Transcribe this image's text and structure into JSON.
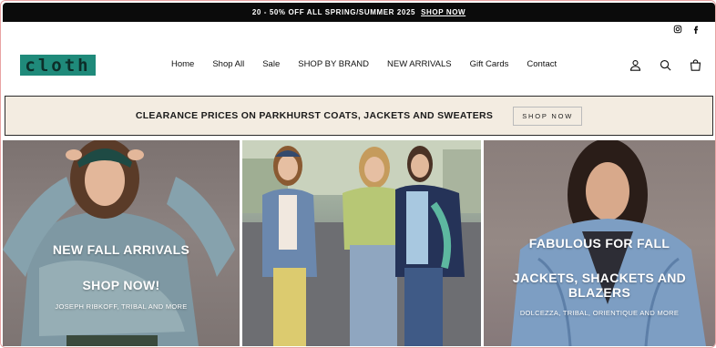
{
  "announcement": {
    "text": "20 - 50% OFF ALL SPRING/SUMMER 2025",
    "link": "SHOP NOW"
  },
  "social": {
    "icons": [
      "instagram-icon",
      "facebook-icon"
    ]
  },
  "header": {
    "logo_text": "cloth",
    "logo_color": "#1f8a7a",
    "nav": [
      "Home",
      "Shop All",
      "Sale",
      "SHOP BY BRAND",
      "NEW ARRIVALS",
      "Gift Cards",
      "Contact"
    ],
    "icons": [
      "account-icon",
      "search-icon",
      "cart-icon"
    ]
  },
  "promo": {
    "text": "CLEARANCE PRICES ON PARKHURST COATS, JACKETS AND SWEATERS",
    "button": "SHOP NOW",
    "bg_color": "#f3ece1"
  },
  "tiles": [
    {
      "headline": "NEW FALL ARRIVALS",
      "cta": "SHOP NOW!",
      "sub": "JOSEPH RIBKOFF, TRIBAL AND MORE"
    },
    {
      "headline": "",
      "cta": "",
      "sub": ""
    },
    {
      "headline": "FABULOUS FOR FALL",
      "cta": "JACKETS, SHACKETS AND BLAZERS",
      "sub": "DOLCEZZA, TRIBAL, ORIENTIQUE AND MORE"
    }
  ]
}
